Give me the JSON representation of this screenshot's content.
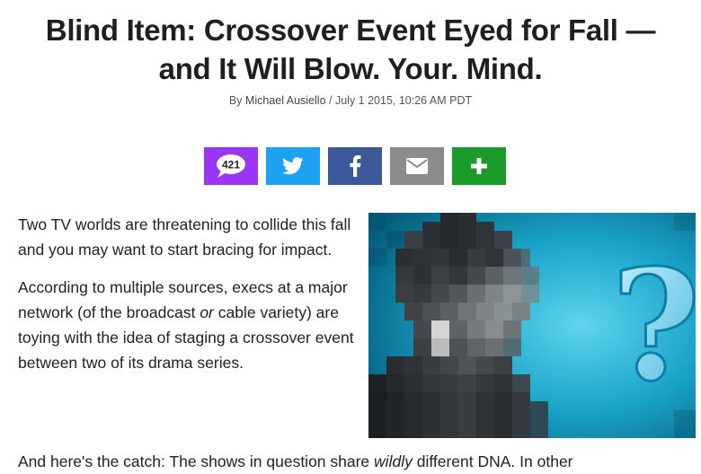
{
  "article": {
    "headline": "Blind Item: Crossover Event Eyed for Fall — and It Will Blow. Your. Mind.",
    "byline_prefix": "By ",
    "author": "Michael Ausiello",
    "byline_separator": " / ",
    "date": "July 1 2015, 10:26 AM PDT",
    "paragraph_1": "Two TV worlds are threatening to collide this fall and you may want to start bracing for impact.",
    "paragraph_2_before": "According to multiple sources, execs at a major network (of the broadcast ",
    "paragraph_2_em": "or",
    "paragraph_2_after": " cable variety) are toying with the idea of staging a crossover event between two of its drama series.",
    "paragraph_3_before": "And here's the catch: The shows in question share ",
    "paragraph_3_em": "wildly",
    "paragraph_3_after": " different DNA. In other"
  },
  "share": {
    "comment_count": "421",
    "colors": {
      "comments": "#9b35f5",
      "twitter": "#1da1f2",
      "facebook": "#3b5998",
      "email": "#8c8c8c",
      "more": "#1a9b2a"
    },
    "icons": [
      "speech-bubble-icon",
      "twitter-bird-icon",
      "facebook-f-icon",
      "envelope-icon",
      "plus-icon"
    ]
  },
  "image": {
    "description_icon": "question-mark-icon",
    "question_mark": "?"
  }
}
